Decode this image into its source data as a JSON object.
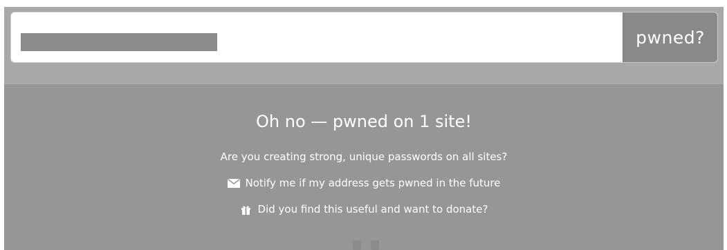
{
  "search": {
    "input_value": "",
    "button_label": "pwned?"
  },
  "result": {
    "title": "Oh no — pwned on 1 site!",
    "question": "Are you creating strong, unique passwords on all sites?",
    "notify_link": "Notify me if my address gets pwned in the future",
    "donate_link": "Did you find this useful and want to donate?"
  },
  "icons": {
    "notify": "envelope-icon",
    "donate": "gift-icon"
  },
  "colors": {
    "panel_background": "#959794",
    "search_strip": "#a7a9a6",
    "button_background": "#888a87",
    "text": "#ffffff"
  }
}
